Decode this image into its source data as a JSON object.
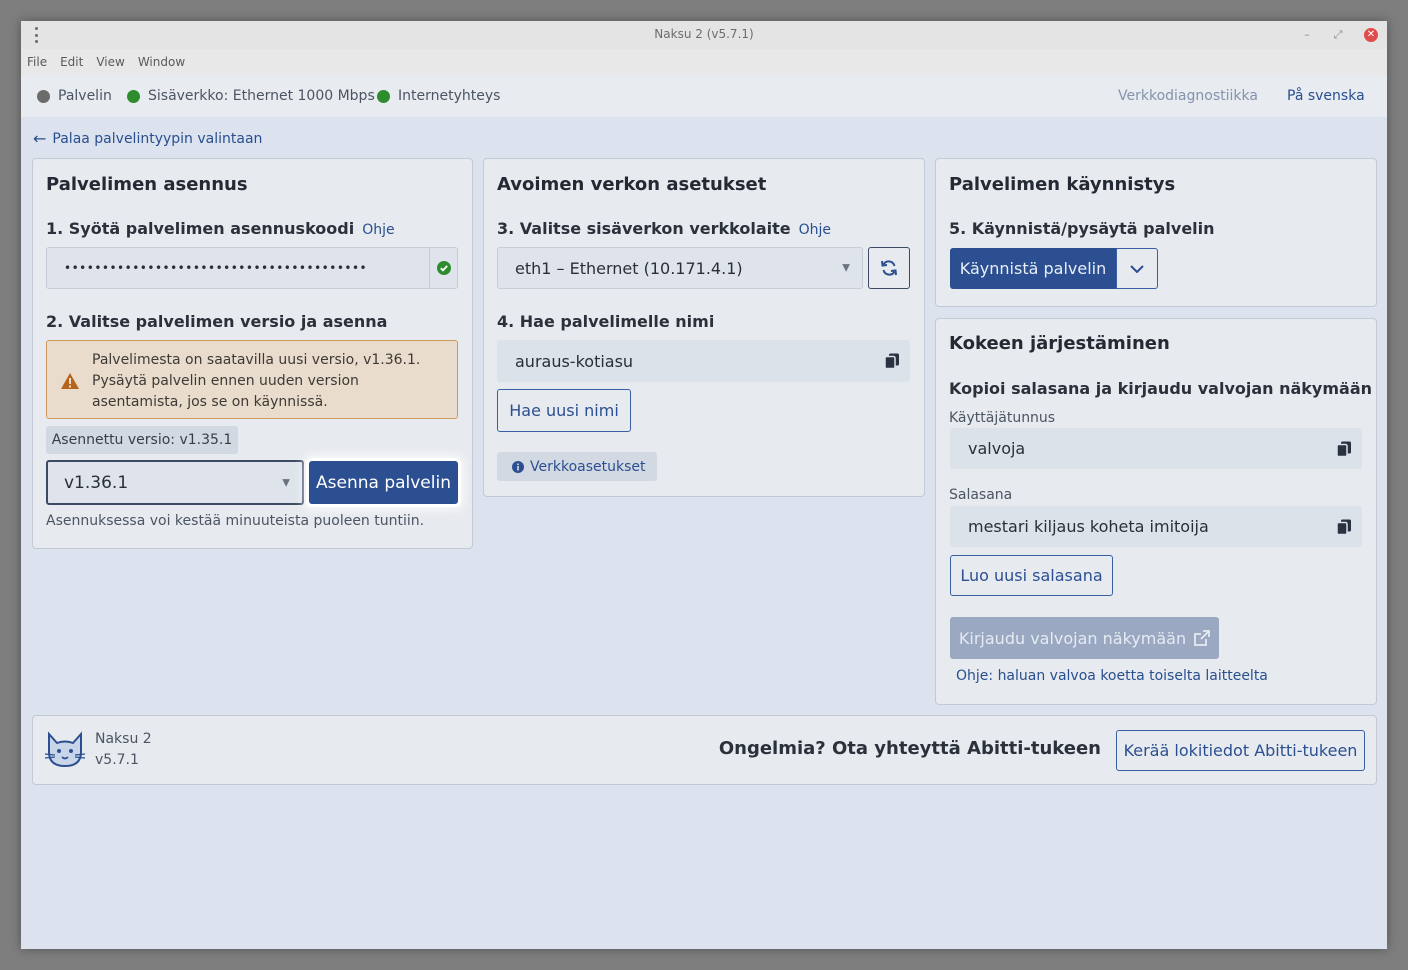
{
  "window": {
    "title": "Naksu 2 (v5.7.1)"
  },
  "menu": [
    "File",
    "Edit",
    "View",
    "Window"
  ],
  "status": {
    "server": "Palvelin",
    "lan": "Sisäverkko: Ethernet 1000 Mbps",
    "internet": "Internetyhteys",
    "network_diagnostics": "Verkkodiagnostiikka",
    "swedish": "På svenska"
  },
  "back_link": "Palaa palvelintyypin valintaan",
  "install_card": {
    "title": "Palvelimen asennus",
    "step1_label": "1. Syötä palvelimen asennuskoodi",
    "step1_help": "Ohje",
    "code_value": "••••••••••••••••••••••••••••••••••••••••",
    "step2_label": "2. Valitse palvelimen versio ja asenna",
    "warning": "Palvelimesta on saatavilla uusi versio, v1.36.1. Pysäytä palvelin ennen uuden version asentamista, jos se on käynnissä.",
    "installed_version": "Asennettu versio: v1.35.1",
    "selected_version": "v1.36.1",
    "install_button": "Asenna palvelin",
    "hint": "Asennuksessa voi kestää minuuteista puoleen tuntiin."
  },
  "network_card": {
    "title": "Avoimen verkon asetukset",
    "step3_label": "3. Valitse sisäverkon verkkolaite",
    "step3_help": "Ohje",
    "device": "eth1 – Ethernet (10.171.4.1)",
    "step4_label": "4. Hae palvelimelle nimi",
    "server_name": "auraus-kotiasu",
    "new_name_button": "Hae uusi nimi",
    "network_settings": "Verkkoasetukset"
  },
  "start_card": {
    "title": "Palvelimen käynnistys",
    "step5_label": "5. Käynnistä/pysäytä palvelin",
    "start_button": "Käynnistä palvelin"
  },
  "exam_card": {
    "title": "Kokeen järjestäminen",
    "subtitle": "Kopioi salasana ja kirjaudu valvojan näkymään",
    "username_label": "Käyttäjätunnus",
    "username": "valvoja",
    "password_label": "Salasana",
    "password": "mestari kiljaus koheta imitoija",
    "new_password_button": "Luo uusi salasana",
    "login_button": "Kirjaudu valvojan näkymään",
    "help_link": "Ohje: haluan valvoa koetta toiselta laitteelta"
  },
  "footer": {
    "app_name": "Naksu 2",
    "version": "v5.7.1",
    "help_text": "Ongelmia? Ota yhteyttä Abitti-tukeen",
    "logs_button": "Kerää lokitiedot Abitti-tukeen"
  },
  "colors": {
    "accent": "#2b4f90",
    "status_ok": "#2d8c2d",
    "warning_border": "#cf9a5e",
    "close_button": "#e04b4b"
  }
}
